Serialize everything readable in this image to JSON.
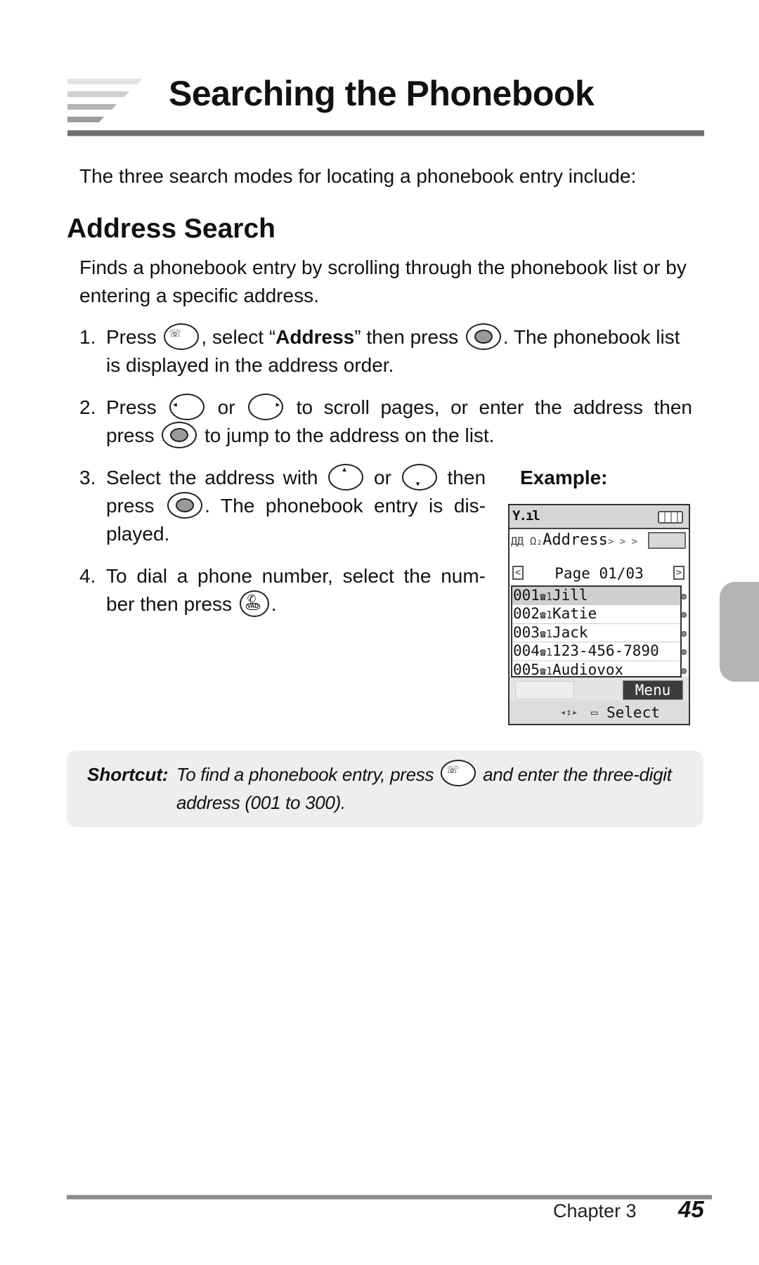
{
  "header": {
    "title": "Searching the Phonebook"
  },
  "intro": "The three search modes for locating a phonebook entry include:",
  "section": {
    "heading": "Address Search",
    "lead": "Finds a phonebook entry by scrolling through the phonebook list or by entering a specific address."
  },
  "steps": [
    {
      "num": "1.",
      "a": "Press",
      "b": ", select “",
      "bold": "Address",
      "c": "” then press",
      "d": ". The phonebook list is displayed in the address order.",
      "icons": [
        "phonebook-key",
        "center-key"
      ]
    },
    {
      "num": "2.",
      "a": "Press",
      "b": "or",
      "c": "to scroll pages, or enter the address then",
      "d": "press",
      "e": "to jump to the address on the list.",
      "icons": [
        "left-key",
        "right-key",
        "center-key"
      ]
    },
    {
      "num": "3.",
      "a": "Select the address with",
      "b": "or",
      "c": "then",
      "d": "press",
      "e": ". The phonebook entry is dis-",
      "f": "played.",
      "icons": [
        "up-key",
        "down-key",
        "center-key"
      ]
    },
    {
      "num": "4.",
      "a": "To dial a phone number, select the num-",
      "b": "ber then press",
      "c": ".",
      "icons": [
        "send-key"
      ]
    }
  ],
  "icons": {
    "phonebook_glyph": "☏",
    "left_glyph": "◂",
    "right_glyph": "▸",
    "up_glyph": "▴",
    "down_glyph": "▾",
    "send_label": "VAD",
    "send_handset": "✆"
  },
  "example": {
    "label": "Example:",
    "phone": {
      "signal": "Y.ıl",
      "mode_icons": "ДД Ω₂",
      "address_label": "Address",
      "address_arrows": "> > >",
      "address_value": "",
      "page_prev": "<",
      "page_next": ">",
      "page_text": "Page 01/03",
      "entries": [
        {
          "addr": "001",
          "name": "Jill",
          "selected": true
        },
        {
          "addr": "002",
          "name": "Katie",
          "selected": false
        },
        {
          "addr": "003",
          "name": "Jack",
          "selected": false
        },
        {
          "addr": "004",
          "name": "123-456-7890",
          "selected": false
        },
        {
          "addr": "005",
          "name": "Audiovox",
          "selected": false
        }
      ],
      "entry_icon": "☎1",
      "softkey_left": "",
      "softkey_right": "Menu",
      "nav_icons": "◂↕▸",
      "select_icon": "▭",
      "select_label": "Select"
    }
  },
  "shortcut": {
    "label": "Shortcut:",
    "text_before": "To find a phonebook entry, press",
    "text_after": "and enter the three-digit address (001 to 300)."
  },
  "footer": {
    "chapter": "Chapter 3",
    "page": "45"
  }
}
